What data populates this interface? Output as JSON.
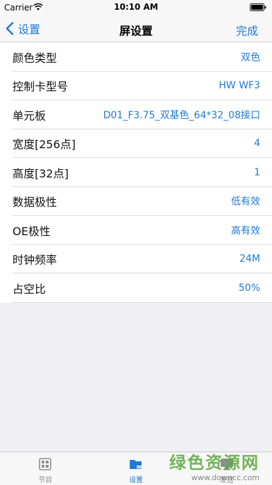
{
  "status_bar": {
    "carrier": "Carrier",
    "time": "10:10 AM"
  },
  "nav": {
    "back_label": "设置",
    "title": "屏设置",
    "done_label": "完成"
  },
  "rows": [
    {
      "label": "颜色类型",
      "value": "双色"
    },
    {
      "label": "控制卡型号",
      "value": "HW WF3"
    },
    {
      "label": "单元板",
      "value": "D01_F3.75_双基色_64*32_08接口"
    },
    {
      "label": "宽度[256点]",
      "value": "4"
    },
    {
      "label": "高度[32点]",
      "value": "1"
    },
    {
      "label": "数据极性",
      "value": "低有效"
    },
    {
      "label": "OE极性",
      "value": "高有效"
    },
    {
      "label": "时钟频率",
      "value": "24M"
    },
    {
      "label": "占空比",
      "value": "50%"
    }
  ],
  "tabs": [
    {
      "label": "节目",
      "icon": "program-icon",
      "active": false
    },
    {
      "label": "设置",
      "icon": "folder-settings-icon",
      "active": true
    },
    {
      "label": "发送",
      "icon": "send-monitor-icon",
      "active": false
    }
  ],
  "watermark": {
    "main": "绿色资源网",
    "url": "www.downcc.com"
  },
  "colors": {
    "accent": "#1e7ad6",
    "background": "#efeff4",
    "tab_inactive": "#8e8e93",
    "watermark": "#5aa83c"
  }
}
